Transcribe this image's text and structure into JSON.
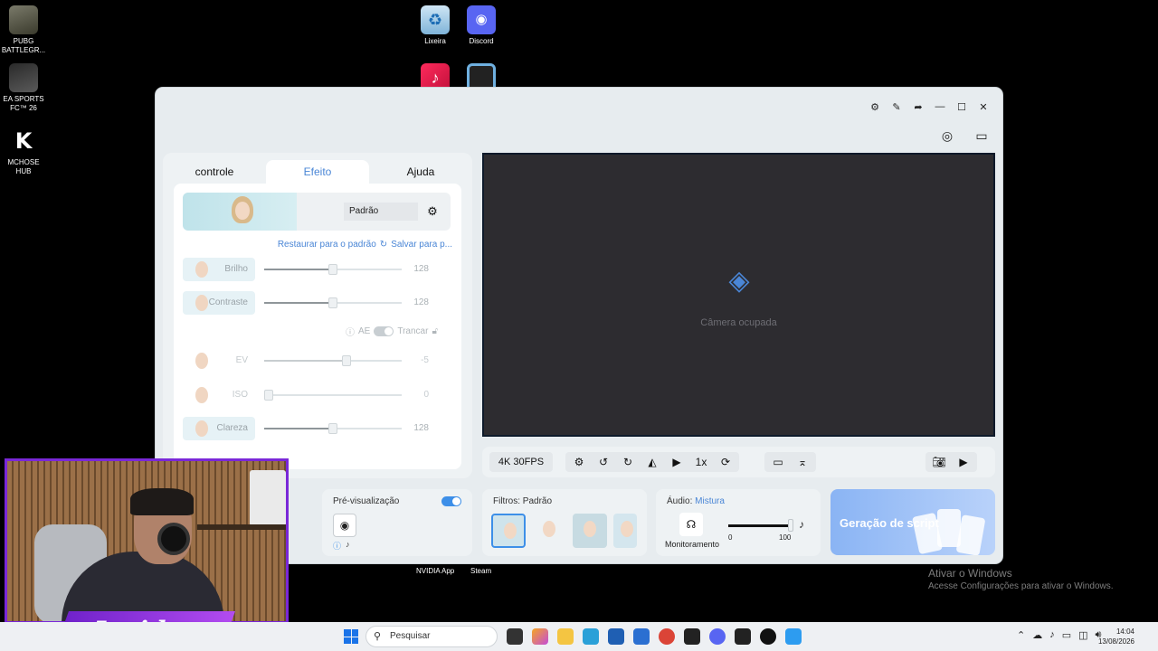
{
  "desktop": {
    "icons_left": [
      {
        "label": "PUBG BATTLEGR...",
        "icon": "pubg-icon"
      },
      {
        "label": "EA SPORTS FC™ 26",
        "icon": "fc26-icon"
      },
      {
        "label": "MCHOSE HUB",
        "icon": "mchose-icon"
      }
    ],
    "icons_top": [
      {
        "label": "Lixeira",
        "icon": "recycle-bin-icon"
      },
      {
        "label": "Discord",
        "icon": "discord-icon"
      },
      {
        "label": "",
        "icon": "tiktok-icon"
      },
      {
        "label": "",
        "icon": "ubisoft-icon"
      }
    ],
    "icons_behind": [
      {
        "label": "NVIDIA App"
      },
      {
        "label": "Steam"
      }
    ],
    "activation": {
      "title": "Ativar o Windows",
      "subtitle": "Acesse Configurações para ativar o Windows."
    }
  },
  "app": {
    "tabs": [
      "controle",
      "Efeito",
      "Ajuda"
    ],
    "active_tab": "Efeito",
    "preset": {
      "name": "Padrão"
    },
    "links": {
      "restore": "Restaurar para o padrão",
      "save": "Salvar para p..."
    },
    "sliders": [
      {
        "label": "Brilho",
        "value": "128",
        "fraction": 0.5
      },
      {
        "label": "Contraste",
        "value": "128",
        "fraction": 0.5
      },
      {
        "label": "EV",
        "value": "-5",
        "fraction": 0.6
      },
      {
        "label": "ISO",
        "value": "0",
        "fraction": 0.0
      },
      {
        "label": "Clareza",
        "value": "128",
        "fraction": 0.5
      }
    ],
    "ae": {
      "label": "AE",
      "lock_label": "Trancar"
    },
    "preview": {
      "message": "Câmera ocupada"
    },
    "toolbar": {
      "resolution": "4K 30FPS",
      "zoom": "1x"
    },
    "previz": {
      "title": "Pré-visualização"
    },
    "filters": {
      "label": "Filtros:",
      "value": "Padrão"
    },
    "audio": {
      "label": "Áudio:",
      "value": "Mistura",
      "monitor": "Monitoramento",
      "min": "0",
      "max": "100"
    },
    "generation": {
      "label": "Geração de script"
    }
  },
  "overlay": {
    "brand": "Insider"
  },
  "taskbar": {
    "search_placeholder": "Pesquisar",
    "time": "14:04",
    "date": "13/08/2026"
  },
  "colors": {
    "accent": "#4a86d6",
    "overlay": "#7a28d8"
  }
}
